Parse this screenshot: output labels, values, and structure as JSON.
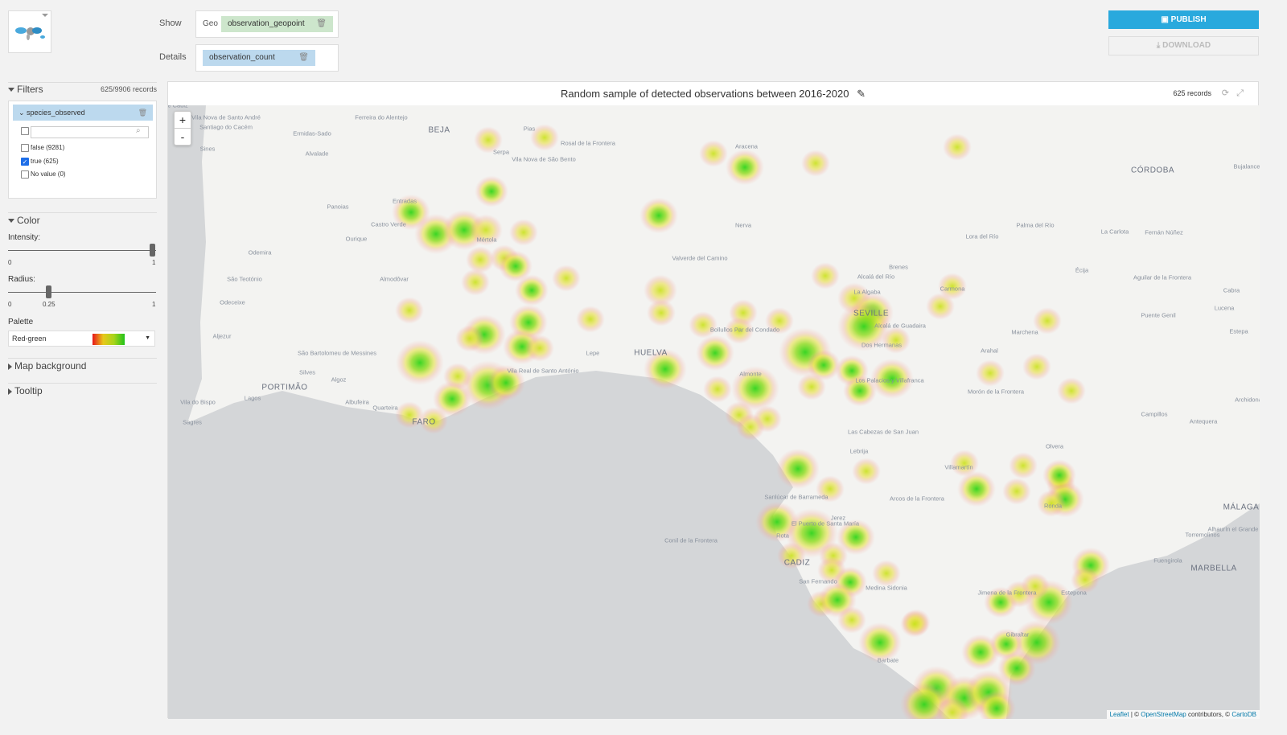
{
  "header": {
    "show_label": "Show",
    "geo_label": "Geo",
    "geo_field": "observation_geopoint",
    "details_label": "Details",
    "details_field": "observation_count",
    "publish": "PUBLISH",
    "download": "DOWNLOAD"
  },
  "filters": {
    "title": "Filters",
    "records": "625/9906 records",
    "facet": "species_observed",
    "search_placeholder": "",
    "options": [
      {
        "label": "false (9281)",
        "checked": false
      },
      {
        "label": "true (625)",
        "checked": true
      },
      {
        "label": "No value (0)",
        "checked": false
      }
    ]
  },
  "color": {
    "title": "Color",
    "intensity_label": "Intensity:",
    "intensity_value": 1,
    "intensity_min": "0",
    "intensity_max": "1",
    "radius_label": "Radius:",
    "radius_value": 0.25,
    "radius_min": "0",
    "radius_mid": "0.25",
    "radius_max": "1",
    "palette_label": "Palette",
    "palette_value": "Red-green"
  },
  "sections": {
    "map_background": "Map background",
    "tooltip": "Tooltip"
  },
  "chart": {
    "title": "Random sample of detected observations between 2016-2020",
    "records": "625 records",
    "zoom_in": "+",
    "zoom_out": "-"
  },
  "places": [
    "Vila Nova de Santo André",
    "Santiago do Cacém",
    "Sines",
    "Ermidas-Sado",
    "Ferreira do Alentejo",
    "BEJA",
    "Alvalade",
    "Serpa",
    "Pias",
    "Vila Nova de São Bento",
    "Rosal de la Frontera",
    "Aracena",
    "CÓRDOBA",
    "Bujalance",
    "Entradas",
    "Castro Verde",
    "Panoias",
    "Ourique",
    "Mértola",
    "Odemira",
    "Almodôvar",
    "São Teotónio",
    "Odeceixe",
    "Aljezur",
    "Silves",
    "São Bartolomeu de Messines",
    "PORTIMÃO",
    "Lagos",
    "Algoz",
    "Albufeira",
    "Quarteira",
    "FARO",
    "Sagres",
    "Vila do Bispo",
    "Vila Real de Santo António",
    "Lepe",
    "HUELVA",
    "Almonte",
    "Nerva",
    "Valverde del Camino",
    "Bollullos Par del Condado",
    "SEVILLE",
    "La Algaba",
    "Alcalá del Río",
    "Brenes",
    "Carmona",
    "Alcalá de Guadaira",
    "Dos Hermanas",
    "Los Palacios y Villafranca",
    "Marchena",
    "Arahal",
    "Morón de la Frontera",
    "Lora del Río",
    "Palma del Río",
    "La Carlota",
    "Fernán Núñez",
    "Écija",
    "Aguilar de la Frontera",
    "Cabra",
    "Lucena",
    "Puente Genil",
    "Estepa",
    "Campillos",
    "Antequera",
    "Archidona",
    "Las Cabezas de San Juan",
    "Lebrija",
    "Sanlúcar de Barrameda",
    "Rota",
    "Jerez",
    "El Puerto de Santa María",
    "CADIZ",
    "San Fernando",
    "Medina Sidonia",
    "Arcos de la Frontera",
    "Villamartín",
    "Olvera",
    "Ronda",
    "MÁLAGA",
    "Alhaurín el Grande",
    "Torremolinos",
    "Fuengirola",
    "MARBELLA",
    "Estepona",
    "Jimena de la Frontera",
    "Gibraltar",
    "Conil de la Frontera",
    "Barbate",
    "Golfo de Cadiz"
  ],
  "attribution": {
    "leaflet": "Leaflet",
    "sep": " | © ",
    "osm": "OpenStreetMap",
    "rest": " contributors, © ",
    "carto": "CartoDB"
  },
  "colors": {
    "accent": "#29a9dd",
    "geo_pill": "#cde6cc",
    "details_pill": "#bcd9ee",
    "sea": "#d4d6d8",
    "land": "#f3f3f1"
  }
}
